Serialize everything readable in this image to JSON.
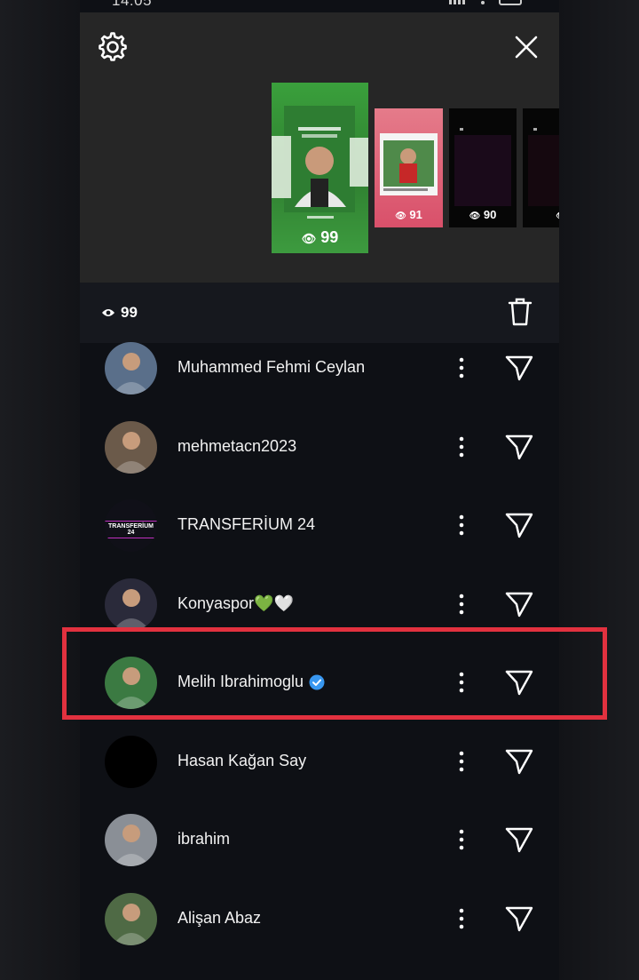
{
  "status_bar": {
    "time": "14:05"
  },
  "story_previews": [
    {
      "views": "99",
      "selected": true
    },
    {
      "views": "91",
      "selected": false
    },
    {
      "views": "90",
      "selected": false
    },
    {
      "views": "",
      "selected": false
    }
  ],
  "views_header": {
    "count": "99",
    "icon": "eye-icon"
  },
  "viewers": [
    {
      "name": "Muhammed Fehmi Ceylan",
      "verified": false,
      "avatar_color": "#5a6f8a"
    },
    {
      "name": "mehmetacn2023",
      "verified": false,
      "avatar_color": "#6b5a4a"
    },
    {
      "name": "TRANSFERİUM 24",
      "verified": false,
      "avatar_color": "#101018",
      "avatar_text": "TRANSFERİUM 24"
    },
    {
      "name": "Konyaspor💚🤍",
      "verified": false,
      "avatar_color": "#2a2a3a"
    },
    {
      "name": "Melih Ibrahimoglu",
      "verified": true,
      "avatar_color": "#3b7a42"
    },
    {
      "name": "Hasan Kağan Say",
      "verified": false,
      "avatar_color": "#000000"
    },
    {
      "name": "ibrahim",
      "verified": false,
      "avatar_color": "#8a8f96"
    },
    {
      "name": "Alişan Abaz",
      "verified": false,
      "avatar_color": "#4f6a45"
    }
  ],
  "colors": {
    "highlight": "#e2313f",
    "verified": "#3897f0",
    "panel": "#262626",
    "list_bg": "#0e1015"
  }
}
